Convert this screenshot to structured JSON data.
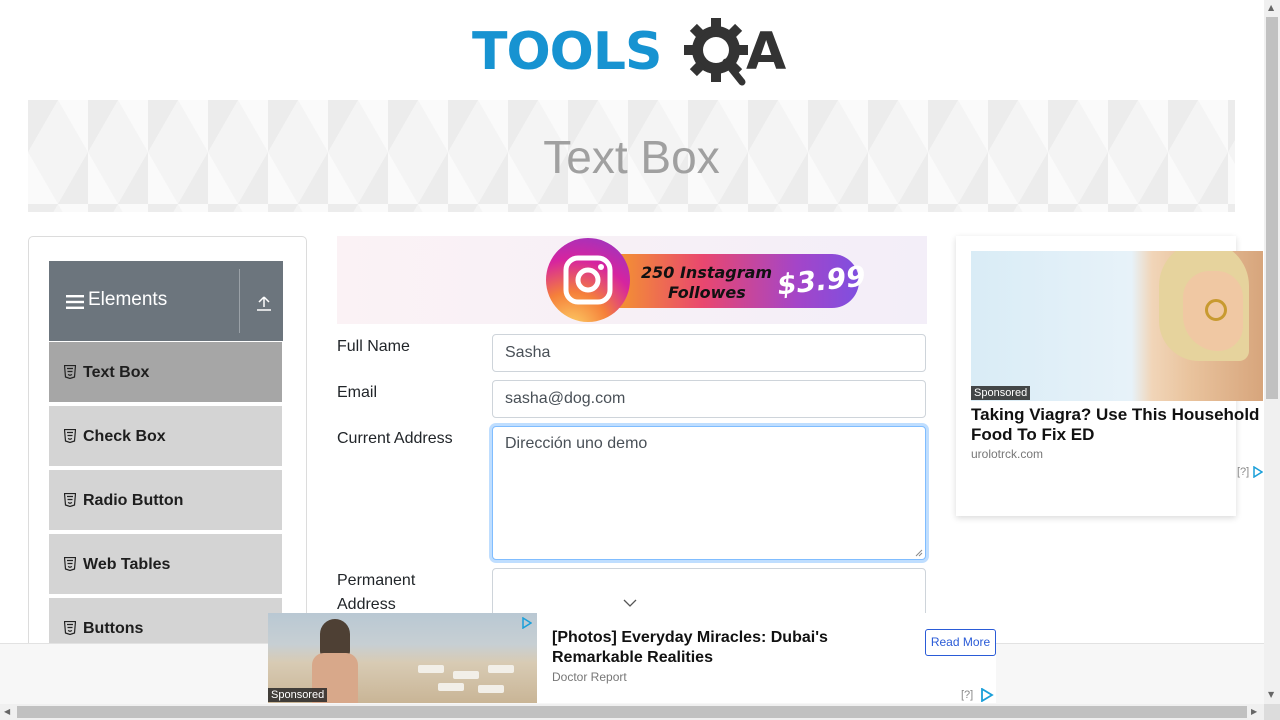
{
  "header": {
    "logo_text": "TOOLS",
    "logo_tail": "A",
    "logo_color_primary": "#1793d1",
    "logo_color_dark": "#333333"
  },
  "banner": {
    "title": "Text Box"
  },
  "sidebar": {
    "group_title": "Elements",
    "group_icon": "hamburger-icon",
    "collapse_icon": "upload-arrow-icon",
    "items": [
      {
        "label": "Text Box",
        "icon": "html5-icon",
        "active": true
      },
      {
        "label": "Check Box",
        "icon": "html5-icon",
        "active": false
      },
      {
        "label": "Radio Button",
        "icon": "html5-icon",
        "active": false
      },
      {
        "label": "Web Tables",
        "icon": "html5-icon",
        "active": false
      },
      {
        "label": "Buttons",
        "icon": "html5-icon",
        "active": false
      }
    ]
  },
  "top_ad": {
    "line1": "250 Instagram",
    "line2": "Followes",
    "price": "$3.99"
  },
  "form": {
    "full_name_label": "Full Name",
    "full_name_value": "Sasha",
    "email_label": "Email",
    "email_value": "sasha@dog.com",
    "current_address_label": "Current Address",
    "current_address_value": "Dirección uno demo",
    "permanent_address_label_line1": "Permanent",
    "permanent_address_label_line2": "Address",
    "focus_color": "#80bdff"
  },
  "right_ad": {
    "badge": "Sponsored",
    "title": "Taking Viagra? Use This Household Food To Fix ED",
    "source": "urolotrck.com",
    "info": "[?]"
  },
  "bottom_ad": {
    "badge": "Sponsored",
    "title": "[Photos] Everyday Miracles: Dubai's Remarkable Realities",
    "source": "Doctor Report",
    "button": "Read More",
    "info": "[?]",
    "button_color": "#2a5bd7"
  }
}
